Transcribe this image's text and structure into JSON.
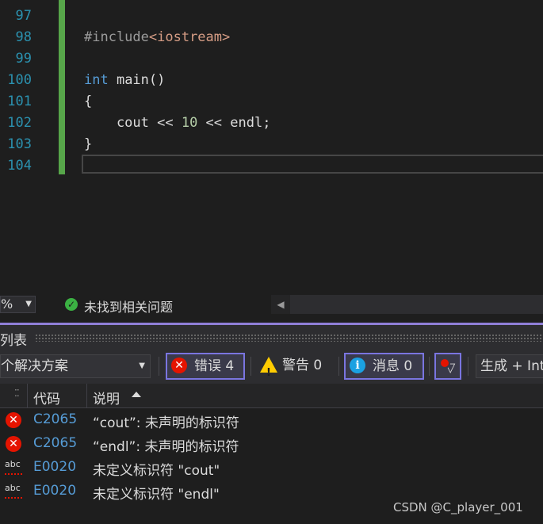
{
  "editor": {
    "line_numbers": [
      "97",
      "98",
      "99",
      "100",
      "101",
      "102",
      "103",
      "104"
    ],
    "code": {
      "include_directive": "#include",
      "include_target": "<iostream>",
      "keyword_int": "int",
      "func_decl": " main()",
      "open_brace": "{",
      "cout_part": "    cout << ",
      "number_literal": "10",
      "endl_part": " << endl;",
      "close_brace": "}"
    }
  },
  "status_bar": {
    "zoom_value": "%",
    "health_text": "未找到相关问题"
  },
  "error_list": {
    "title": "列表",
    "scope": "个解决方案",
    "errors_label": "错误 4",
    "warnings_label": "警告 0",
    "messages_label": "消息 0",
    "build_filter": "生成 + IntelliSense",
    "columns": {
      "code": "代码",
      "description": "说明"
    },
    "rows": [
      {
        "severity": "error",
        "code": "C2065",
        "description": "“cout”: 未声明的标识符"
      },
      {
        "severity": "error",
        "code": "C2065",
        "description": "“endl”: 未声明的标识符"
      },
      {
        "severity": "intellisense",
        "code": "E0020",
        "description": "未定义标识符 \"cout\""
      },
      {
        "severity": "intellisense",
        "code": "E0020",
        "description": "未定义标识符 \"endl\""
      }
    ]
  },
  "watermark": "CSDN @C_player_001",
  "colors": {
    "accent": "#8f7fd8",
    "error": "#e51400",
    "warning": "#ffcc00",
    "info": "#1ba1e2",
    "change_bar": "#57a64a",
    "code_link": "#569cd6"
  },
  "icons": [
    "check-circle-icon",
    "error-icon",
    "warning-icon",
    "info-icon",
    "filter-icon",
    "intellisense-abc-icon",
    "sort-ascending-icon"
  ]
}
